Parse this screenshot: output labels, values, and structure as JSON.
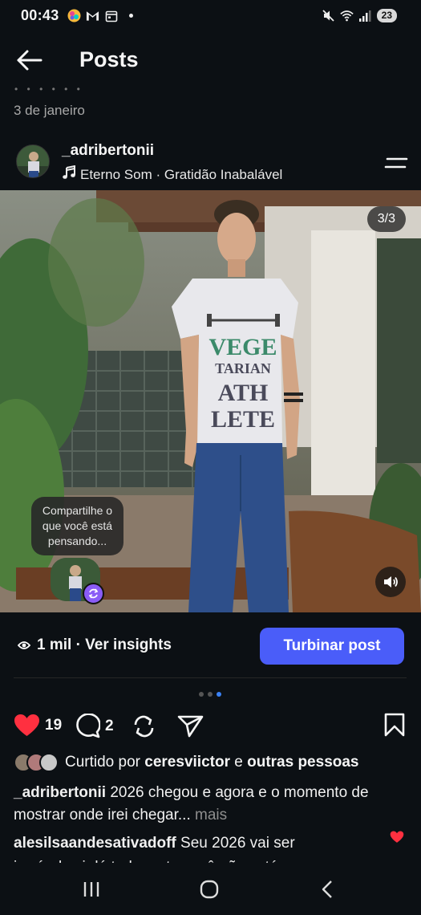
{
  "status_bar": {
    "time": "00:43",
    "battery": "23",
    "left_icons": [
      "colorful-app-icon",
      "gmail-icon",
      "calendar-icon"
    ],
    "right_icons": [
      "mute-icon",
      "wifi-icon",
      "signal-icon"
    ]
  },
  "header": {
    "title": "Posts"
  },
  "previous_post": {
    "date": "3 de janeiro"
  },
  "post": {
    "username": "_adribertonii",
    "music": "Eterno Som · Gratidão Inabalável",
    "counter": "3/3",
    "share_bubble": "Compartilhe o que você está pensando...",
    "insights": "1 mil · Ver insights",
    "boost_label": "Turbinar post",
    "carousel_total": 3,
    "carousel_active": 3,
    "likes": "19",
    "comments": "2",
    "liked_by_prefix": "Curtido por",
    "liked_by_user": "ceresviictor",
    "liked_by_suffix": "e",
    "liked_by_others": "outras pessoas",
    "caption_user": "_adribertonii",
    "caption_text": "2026 chegou e agora e o momento de mostrar onde irei chegar...",
    "more_label": "mais",
    "comment_user": "alesilsaandesativadoff",
    "comment_text": "Seu 2026 vai ser",
    "comment_cut_text": "incrível vai dá tudo certo você não está"
  },
  "colors": {
    "background": "#0c1014",
    "accent": "#4a5df9",
    "like": "#ff3040",
    "active_dot": "#3b82f6"
  }
}
